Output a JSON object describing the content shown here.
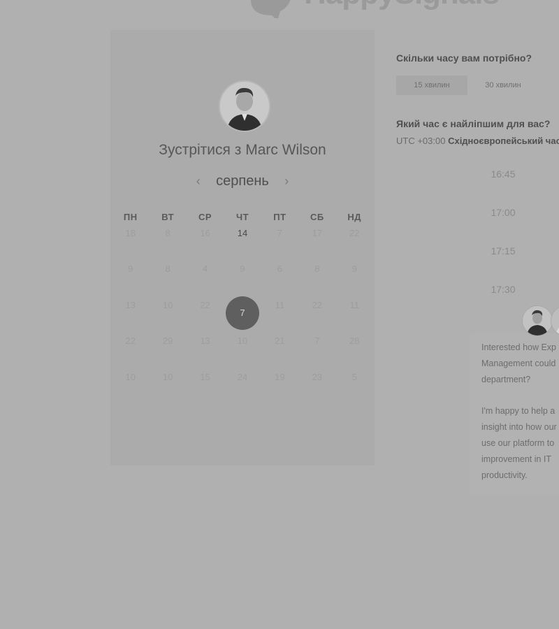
{
  "brand": {
    "name": "HappySignals"
  },
  "calendar": {
    "title_prefix": "Зустрітися з",
    "host_name": "Marc Wilson",
    "month": "серпень",
    "prev_icon": "‹",
    "next_icon": "›",
    "weekdays": [
      "ПН",
      "ВТ",
      "СР",
      "ЧТ",
      "ПТ",
      "СБ",
      "НД"
    ],
    "weeks": [
      [
        "18",
        "8",
        "16",
        "14",
        "7",
        "17",
        "22"
      ],
      [
        "9",
        "8",
        "4",
        "9",
        "6",
        "8",
        "9"
      ],
      [
        "13",
        "10",
        "22",
        "7",
        "11",
        "22",
        "11"
      ],
      [
        "22",
        "29",
        "13",
        "10",
        "21",
        "7",
        "28"
      ],
      [
        "10",
        "10",
        "15",
        "24",
        "19",
        "23",
        "5"
      ]
    ],
    "available": [
      [
        0,
        3
      ]
    ],
    "selected": [
      2,
      3
    ]
  },
  "duration": {
    "question": "Скільки часу вам потрібно?",
    "options": [
      "15 хвилин",
      "30 хвилин"
    ],
    "selected_index": 0
  },
  "time": {
    "question": "Який час є найліпшим для вас?",
    "timezone_offset": "UTC +03:00",
    "timezone_name": "Східноєвропейський час",
    "slots": [
      "16:45",
      "17:00",
      "17:15",
      "17:30"
    ]
  },
  "chat": {
    "paragraph1": [
      "Interested how Exp",
      "Management could",
      "department?"
    ],
    "paragraph2": [
      "I'm happy to help a",
      "insight into how our",
      "use our platform to",
      "improvement in IT",
      "productivity."
    ]
  },
  "colors": {
    "background": "#b0b0b0",
    "card": "#ababab",
    "selected_day": "#5f5f5f"
  }
}
